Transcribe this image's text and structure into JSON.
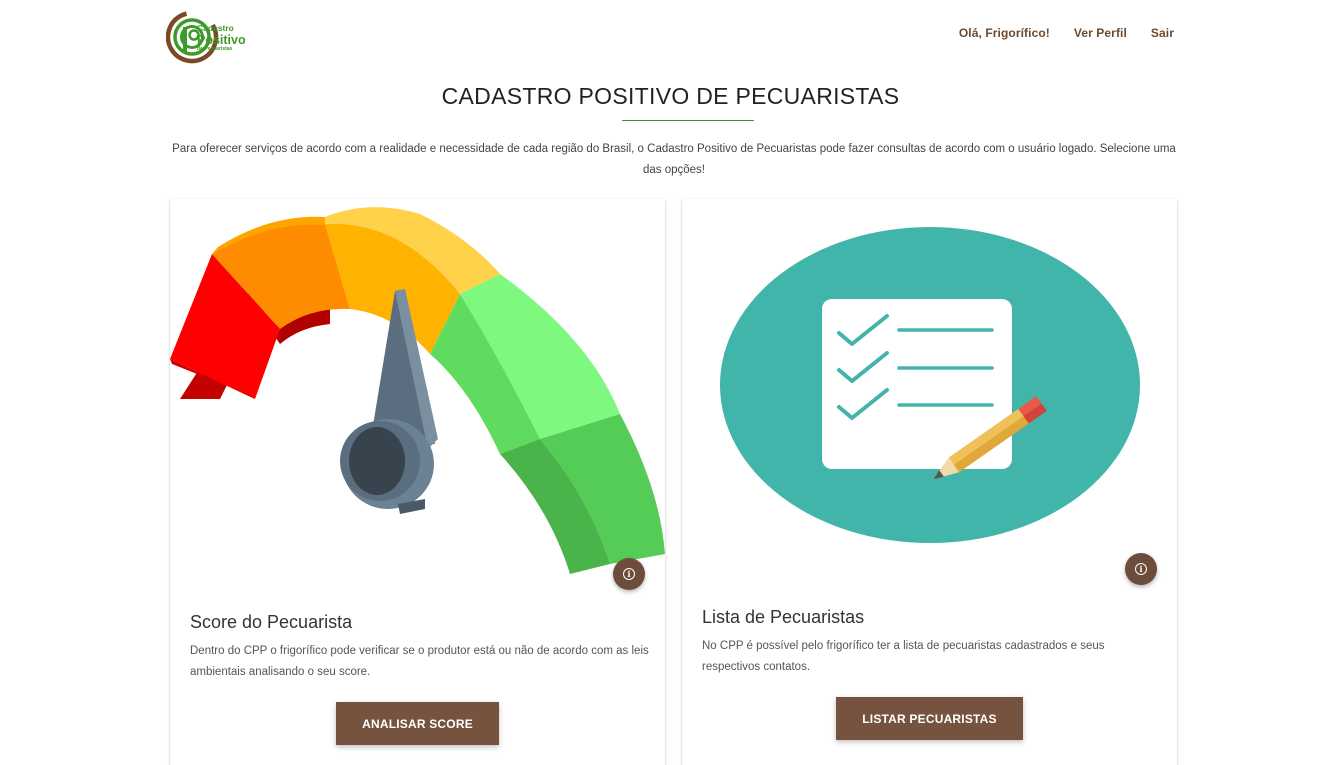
{
  "logo": {
    "line1": "Cadastro",
    "line2": "Positivo",
    "line3": "de Pecuaristas",
    "colors": {
      "green": "#3d9a2a",
      "brown": "#7a4a26"
    }
  },
  "nav": {
    "greeting": "Olá, Frigorífico!",
    "profile": "Ver Perfil",
    "logout": "Sair"
  },
  "page": {
    "title": "CADASTRO POSITIVO DE PECUARISTAS",
    "intro": "Para oferecer serviços de acordo com a realidade e necessidade de cada região do Brasil, o Cadastro Positivo de Pecuaristas pode fazer consultas de acordo com o usuário logado. Selecione uma das opções!"
  },
  "cards": [
    {
      "image": "speedometer-gauge-illustration",
      "info_icon": "info-icon",
      "title": "Score do Pecuarista",
      "text": "Dentro do CPP o frigorífico pode verificar se o produtor está ou não de acordo com as leis ambientais analisando o seu score.",
      "button": "ANALISAR SCORE"
    },
    {
      "image": "checklist-pencil-illustration",
      "info_icon": "info-icon",
      "title": "Lista de Pecuaristas",
      "text": "No CPP é possível pelo frigorífico ter a lista de pecuaristas cadastrados e seus respectivos contatos.",
      "button": "LISTAR PECUARISTAS"
    }
  ],
  "colors": {
    "accent_brown": "#76533f",
    "nav_link": "#6b4a2e",
    "title_rule": "#4c8a2f",
    "teal": "#42b5aa"
  }
}
